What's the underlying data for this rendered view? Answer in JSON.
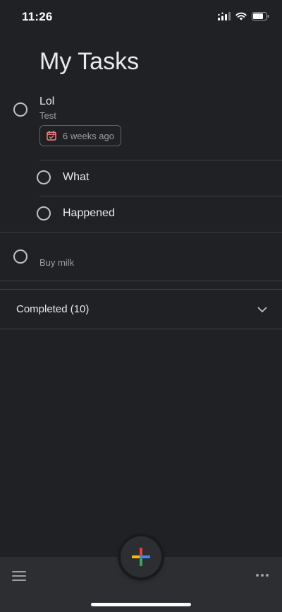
{
  "status_bar": {
    "time": "11:26",
    "icons": [
      "cellular-signal-icon",
      "wifi-icon",
      "battery-icon"
    ]
  },
  "page_title": "My Tasks",
  "tasks": [
    {
      "title": "Lol",
      "note": "Test",
      "due_label": "6 weeks ago",
      "due_icon": "calendar-icon",
      "subtasks": [
        {
          "title": "What"
        },
        {
          "title": "Happened"
        }
      ]
    },
    {
      "title": "",
      "note": "Buy milk"
    }
  ],
  "completed_section": {
    "label": "Completed (10)",
    "icon": "chevron-down-icon"
  },
  "bottom_bar": {
    "left_icon": "menu-icon",
    "right_icon": "more-horizontal-icon",
    "fab_icon": "add-icon"
  },
  "colors": {
    "background": "#202124",
    "bottom_bar": "#2d2e31",
    "text_primary": "#e8eaed",
    "text_secondary": "#9aa0a6",
    "divider": "#3c4043",
    "calendar_accent": "#f28b82",
    "google_blue": "#4285f4",
    "google_red": "#ea4335",
    "google_yellow": "#fbbc04",
    "google_green": "#34a853"
  }
}
